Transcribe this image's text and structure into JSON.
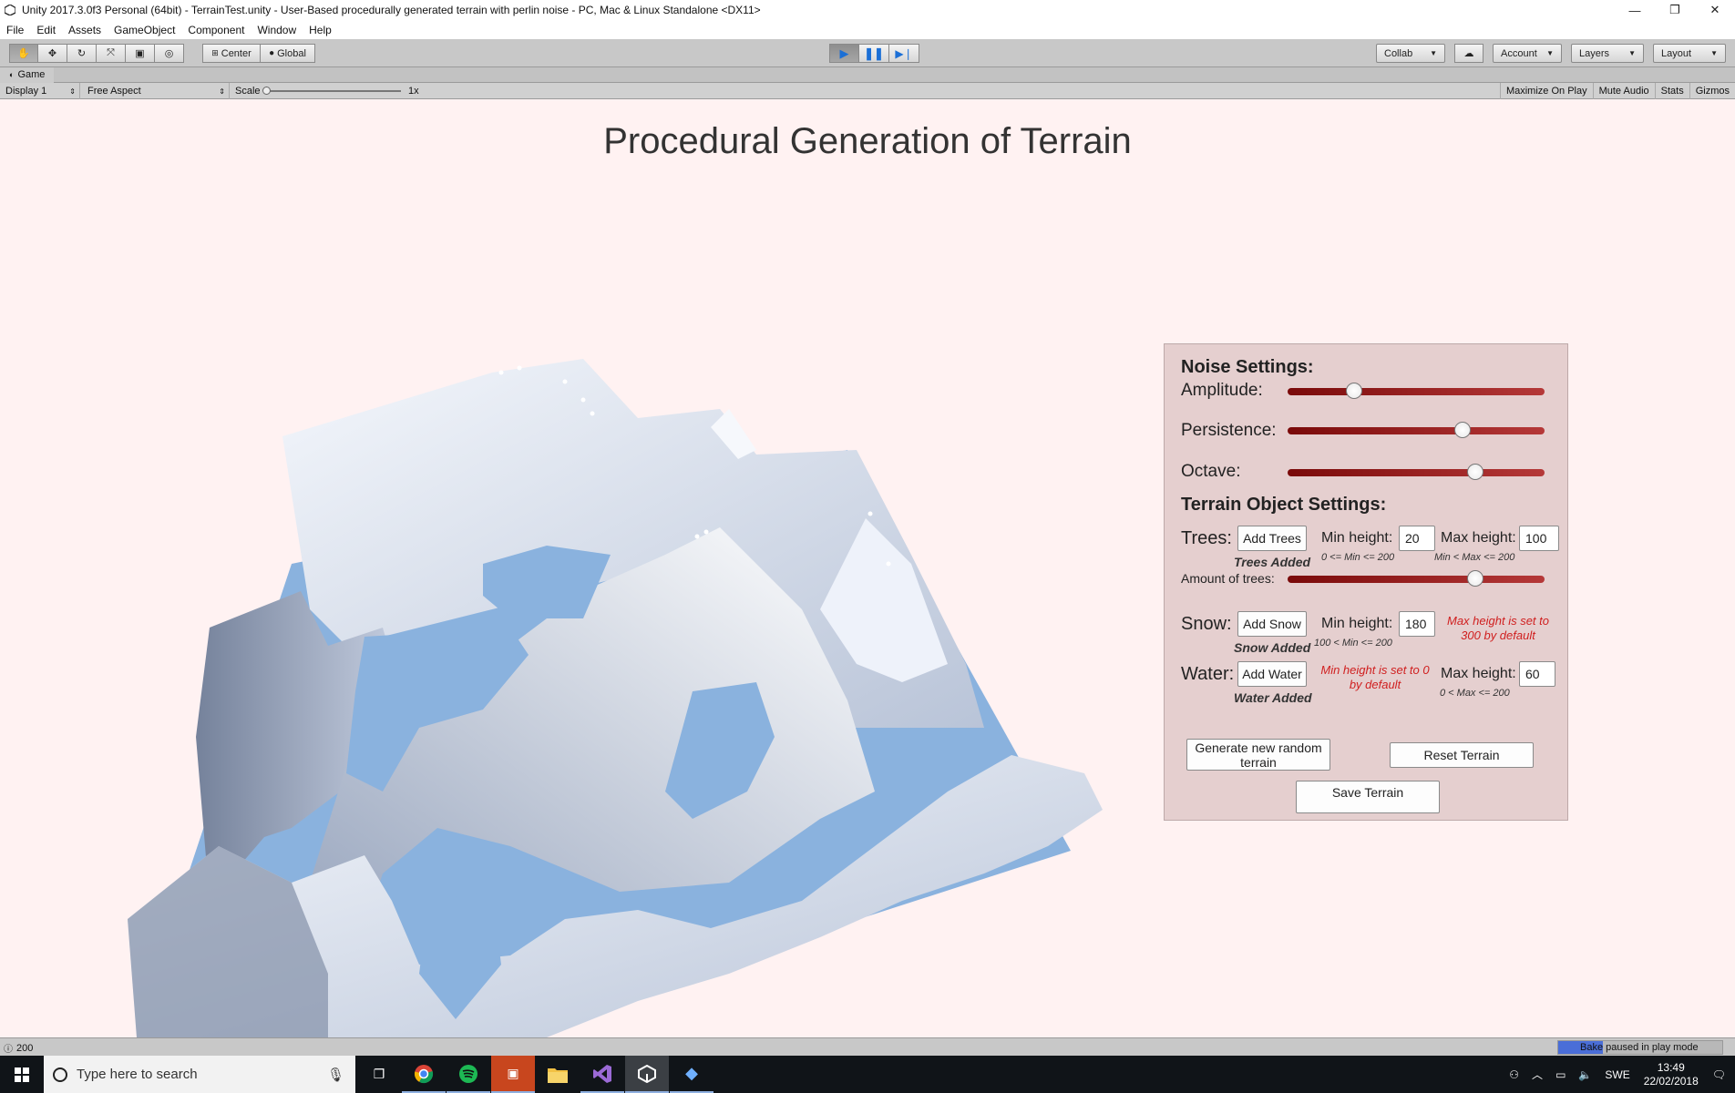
{
  "window": {
    "title": "Unity 2017.3.0f3 Personal (64bit) - TerrainTest.unity - User-Based procedurally generated terrain with perlin noise - PC, Mac & Linux Standalone <DX11>",
    "minimize": "—",
    "restore": "❐",
    "close": "✕"
  },
  "menu": [
    "File",
    "Edit",
    "Assets",
    "GameObject",
    "Component",
    "Window",
    "Help"
  ],
  "toolbar": {
    "pivot_center": "Center",
    "pivot_global": "Global",
    "collab": "Collab",
    "account": "Account",
    "layers": "Layers",
    "layout": "Layout"
  },
  "game_tab": {
    "label": "Game",
    "display": "Display 1",
    "aspect": "Free Aspect",
    "scale_label": "Scale",
    "scale_value": "1x",
    "maximize_on_play": "Maximize On Play",
    "mute_audio": "Mute Audio",
    "stats": "Stats",
    "gizmos": "Gizmos"
  },
  "game": {
    "title": "Procedural Generation of Terrain",
    "colors": {
      "background": "#fff2f2",
      "water": "#8ab2de",
      "snow": "#e8eef8",
      "panel": "#e5cfcf"
    },
    "panel": {
      "noise_heading": "Noise Settings:",
      "amplitude_label": "Amplitude:",
      "amplitude_level": 0.26,
      "persistence_label": "Persistence:",
      "persistence_level": 0.68,
      "octave_label": "Octave:",
      "octave_level": 0.73,
      "terrain_heading": "Terrain Object Settings:",
      "trees": {
        "label": "Trees:",
        "button": "Add Trees",
        "status": "Trees Added",
        "min_label": "Min height:",
        "min_value": "20",
        "min_hint": "0 <= Min <= 200",
        "max_label": "Max height:",
        "max_value": "100",
        "max_hint": "Min < Max <= 200",
        "amount_label": "Amount of trees:",
        "amount_level": 0.73
      },
      "snow": {
        "label": "Snow:",
        "button": "Add Snow",
        "status": "Snow Added",
        "min_label": "Min height:",
        "min_value": "180",
        "min_hint": "100 < Min <= 200",
        "max_note": "Max height is set to 300 by default"
      },
      "water": {
        "label": "Water:",
        "button": "Add Water",
        "status": "Water Added",
        "min_note": "Min height is set to 0 by default",
        "max_label": "Max height:",
        "max_value": "60",
        "max_hint": "0 < Max <= 200"
      },
      "generate_button": "Generate new random terrain",
      "reset_button": "Reset Terrain",
      "save_button": "Save Terrain"
    }
  },
  "status_bar": {
    "count": "200",
    "bake_text": "Bake paused in play mode",
    "bake_progress": 0.27
  },
  "taskbar": {
    "search_placeholder": "Type here to search",
    "language": "SWE",
    "time": "13:49",
    "date": "22/02/2018"
  }
}
